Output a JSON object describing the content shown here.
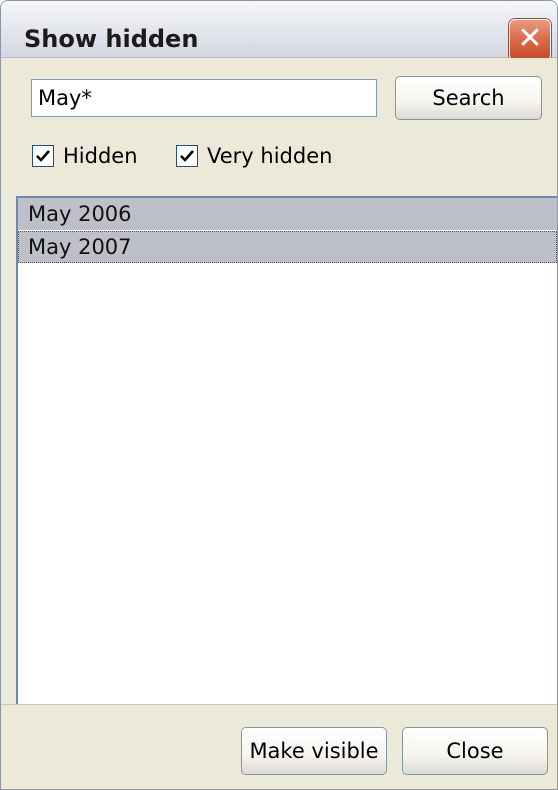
{
  "window": {
    "title": "Show hidden",
    "close_glyph": "✕"
  },
  "search": {
    "value": "May*",
    "button_label": "Search"
  },
  "filters": {
    "hidden_label": "Hidden",
    "hidden_checked": true,
    "very_hidden_label": "Very hidden",
    "very_hidden_checked": true
  },
  "results": {
    "items": [
      {
        "label": "May 2006",
        "selected": true
      },
      {
        "label": "May 2007",
        "selected": true,
        "focused": true
      }
    ]
  },
  "footer": {
    "make_visible_label": "Make visible",
    "close_label": "Close"
  },
  "colors": {
    "selection": "#bdc0c9",
    "close_button": "#d96a4a",
    "dialog_bg": "#ece9d8"
  }
}
